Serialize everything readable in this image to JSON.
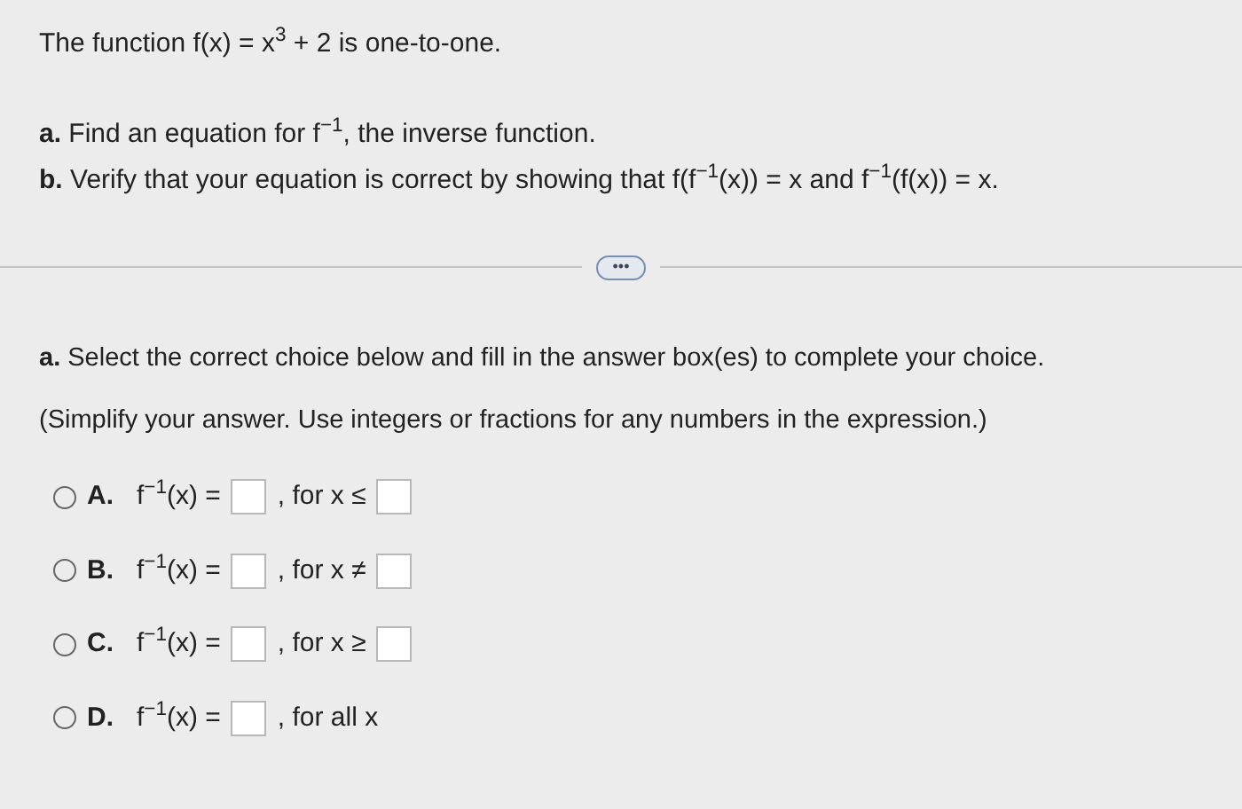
{
  "problem": {
    "statement": "The function f(x) = x$^{3}$ + 2 is one-to-one.",
    "parts": [
      "**a.** Find an equation for f$^{−1}$, the inverse function.",
      "**b.** Verify that your equation is correct by showing that f(f$^{−1}$(x)) = x and f$^{−1}$(f(x)) = x."
    ]
  },
  "more_button": "•••",
  "question": {
    "instruction": "**a.** Select the correct choice below and fill in the answer box(es) to complete your choice.",
    "hint": "(Simplify your answer. Use integers or fractions for any numbers in the expression.)"
  },
  "choices": [
    {
      "letter": "A.",
      "expression": "f$^{−1}$(x) =",
      "condition": ", for x ≤",
      "has_condition_box": true,
      "selected": false
    },
    {
      "letter": "B.",
      "expression": "f$^{−1}$(x) =",
      "condition": ", for x ≠",
      "has_condition_box": true,
      "selected": false
    },
    {
      "letter": "C.",
      "expression": "f$^{−1}$(x) =",
      "condition": ", for x ≥",
      "has_condition_box": true,
      "selected": false
    },
    {
      "letter": "D.",
      "expression": "f$^{−1}$(x) =",
      "condition": ", for all x",
      "has_condition_box": false,
      "selected": false
    }
  ]
}
